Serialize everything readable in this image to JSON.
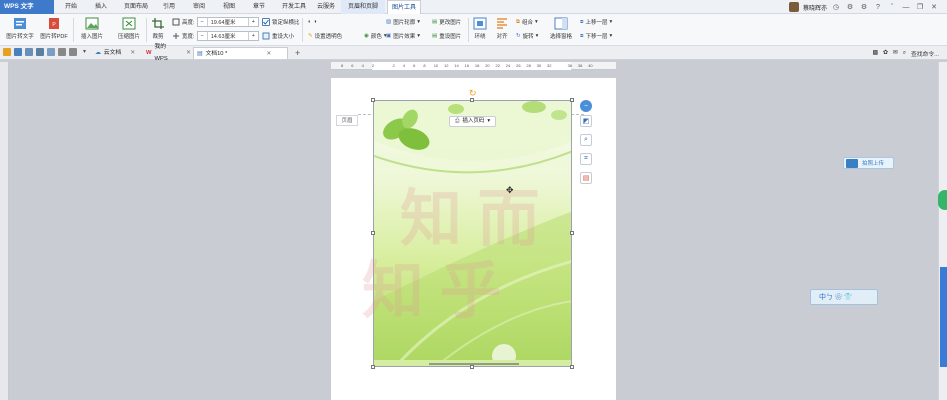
{
  "app": {
    "name": "WPS 文字"
  },
  "menu_tabs": [
    "开始",
    "插入",
    "页面布局",
    "引用",
    "审阅",
    "视图",
    "章节",
    "开发工具",
    "云服务",
    "页眉和页脚",
    "图片工具"
  ],
  "user": {
    "name": "蔡晓辉亦"
  },
  "ribbon": {
    "img_to_text": "图片转文字",
    "img_to_pdf": "图片转PDF",
    "insert_picture": "插入图片",
    "compress_picture": "压缩图片",
    "crop": "裁剪",
    "height_label": "高度:",
    "height_value": "19.64厘米",
    "width_label": "宽度:",
    "width_value": "14.63厘米",
    "lock_ratio": "锁定纵横比",
    "reset_size": "重设大小",
    "set_transparent": "设置透明色",
    "color": "颜色",
    "picture_outline": "图片轮廓",
    "picture_effect": "图片效果",
    "change_picture": "更改图片",
    "reset_picture": "重设图片",
    "wrap": "环绕",
    "align": "对齐",
    "group": "组合",
    "rotate": "旋转",
    "selection_pane": "选择窗格",
    "bring_forward": "上移一层",
    "send_backward": "下移一层"
  },
  "doc_tabs": [
    {
      "label": "云文档"
    },
    {
      "label": "我的WPS"
    },
    {
      "label": "文档10 *"
    }
  ],
  "search": {
    "placeholder": "查找命令..."
  },
  "ruler": {
    "ticks": [
      "8",
      "6",
      "4",
      "2",
      "",
      "2",
      "4",
      "6",
      "8",
      "10",
      "12",
      "14",
      "16",
      "18",
      "20",
      "22",
      "24",
      "26",
      "28",
      "30",
      "32",
      "",
      "36",
      "38",
      "40"
    ]
  },
  "document": {
    "header_tag": "页眉",
    "insert_page_number": "插入页码",
    "watermark_1": "知 而",
    "watermark_2": "知 乎"
  },
  "floating": {
    "upload": "拍照上传",
    "ime": "中ㄅ ❀ 👕"
  },
  "colors": {
    "accent": "#3f79c9",
    "ctx_tab": "#dfe9f7",
    "scroll_thumb": "#3a7bd5"
  }
}
